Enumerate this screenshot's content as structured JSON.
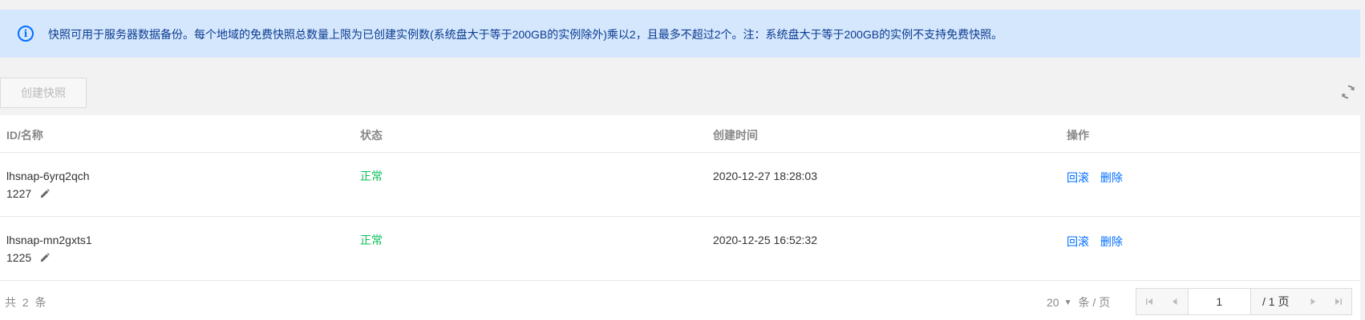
{
  "notice": {
    "text": "快照可用于服务器数据备份。每个地域的免费快照总数量上限为已创建实例数(系统盘大于等于200GB的实例除外)乘以2，且最多不超过2个。注：系统盘大于等于200GB的实例不支持免费快照。"
  },
  "toolbar": {
    "create_label": "创建快照"
  },
  "table": {
    "columns": [
      "ID/名称",
      "状态",
      "创建时间",
      "操作"
    ],
    "rows": [
      {
        "id": "lhsnap-6yrq2qch",
        "name": "1227",
        "status": "正常",
        "time": "2020-12-27 18:28:03",
        "ops": [
          "回滚",
          "删除"
        ]
      },
      {
        "id": "lhsnap-mn2gxts1",
        "name": "1225",
        "status": "正常",
        "time": "2020-12-25 16:52:32",
        "ops": [
          "回滚",
          "删除"
        ]
      }
    ]
  },
  "footer": {
    "total": "共 2 条",
    "page_size": "20",
    "page_size_unit": "条 / 页",
    "current_page": "1",
    "total_pages": "/ 1 页"
  },
  "colors": {
    "accent": "#006eff",
    "status_ok": "#0abf5b",
    "notice_bg": "#d5e7fd"
  }
}
